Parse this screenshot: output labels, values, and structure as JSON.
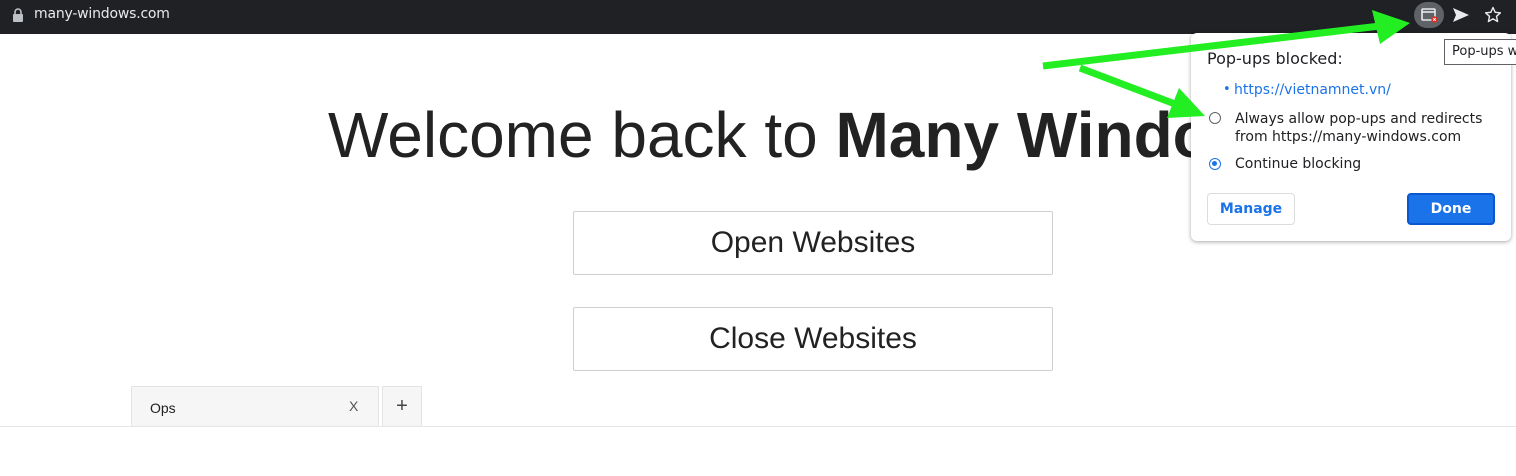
{
  "browser": {
    "url": "many-windows.com",
    "icons": {
      "lock": "lock-icon",
      "popup_blocked": "popup-blocked-icon",
      "send": "send-icon",
      "star": "bookmark-star-icon"
    }
  },
  "page": {
    "welcome_prefix": "Welcome back to ",
    "welcome_bold": "Many Windows",
    "open_button": "Open Websites",
    "close_button": "Close Websites"
  },
  "tabs": {
    "items": [
      {
        "label": "Ops",
        "close": "X"
      }
    ],
    "add_label": "+"
  },
  "popup_bubble": {
    "title": "Pop-ups blocked:",
    "bullet": "•",
    "blocked_link": "https://vietnamnet.vn/",
    "option_allow_line1": "Always allow pop-ups and redirects",
    "option_allow_line2": "from https://many-windows.com",
    "option_block": "Continue blocking",
    "selected_option": "Continue blocking",
    "manage_label": "Manage",
    "done_label": "Done"
  },
  "tooltip": {
    "text": "Pop-ups w"
  },
  "colors": {
    "accent": "#1a73e8",
    "arrow": "#22ee22",
    "toolbar": "#202124"
  }
}
